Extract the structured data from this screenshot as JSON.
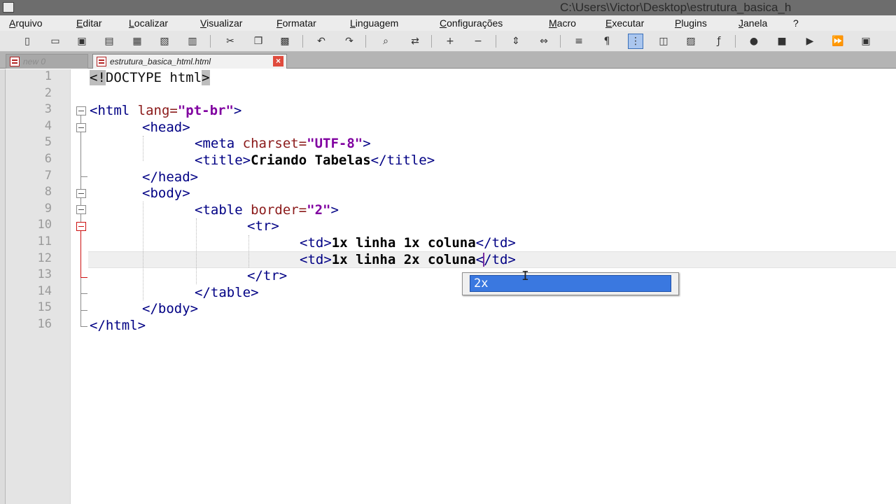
{
  "window": {
    "title": "C:\\Users\\Victor\\Desktop\\estrutura_basica_h"
  },
  "menu": {
    "items": [
      "Arquivo",
      "Editar",
      "Localizar",
      "Visualizar",
      "Formatar",
      "Linguagem",
      "Configurações",
      "Macro",
      "Executar",
      "Plugins",
      "Janela",
      "?"
    ]
  },
  "toolbar": {
    "icons": [
      "new-file-icon",
      "open-file-icon",
      "save-icon",
      "save-all-icon",
      "close-icon",
      "close-all-icon",
      "print-icon",
      "cut-icon",
      "copy-icon",
      "paste-icon",
      "undo-icon",
      "redo-icon",
      "find-icon",
      "replace-icon",
      "zoom-in-icon",
      "zoom-out-icon",
      "sync-vertical-icon",
      "sync-horizontal-icon",
      "word-wrap-icon",
      "show-all-chars-icon",
      "indent-guide-icon",
      "user-language-icon",
      "doc-map-icon",
      "function-list-icon",
      "macro-record-icon",
      "macro-stop-icon",
      "macro-play-icon",
      "macro-run-multiple-icon",
      "macro-save-icon"
    ]
  },
  "tabs": [
    {
      "label": "new 0",
      "active": false
    },
    {
      "label": "estrutura_basica_html.html",
      "active": true
    }
  ],
  "editor": {
    "line_numbers": [
      "1",
      "2",
      "3",
      "4",
      "5",
      "6",
      "7",
      "8",
      "9",
      "10",
      "11",
      "12",
      "13",
      "14",
      "15",
      "16"
    ],
    "lines": {
      "l1": {
        "open": "<!",
        "doctype": "DOCTYPE html",
        "close": ">"
      },
      "l3": {
        "tag_open": "<html ",
        "attr": "lang=",
        "value": "\"pt-br\"",
        "tag_close": ">"
      },
      "l4": {
        "tag": "<head>"
      },
      "l5": {
        "tag_open": "<meta ",
        "attr": "charset=",
        "value": "\"UTF-8\"",
        "tag_close": ">"
      },
      "l6": {
        "tag_open": "<title>",
        "text": "Criando Tabelas",
        "tag_close": "</title>"
      },
      "l7": {
        "tag": "</head>"
      },
      "l8": {
        "tag": "<body>"
      },
      "l9": {
        "tag_open": "<table ",
        "attr": "border=",
        "value": "\"2\"",
        "tag_close": ">"
      },
      "l10": {
        "tag": "<tr>"
      },
      "l11": {
        "tag_open": "<td>",
        "text": "1x linha 1x coluna",
        "tag_close": "</td>"
      },
      "l12": {
        "tag_open": "<td>",
        "text": "1x linha 2x coluna",
        "tag_close": "</td>"
      },
      "l13": {
        "tag": "</tr>"
      },
      "l14": {
        "tag": "</table>"
      },
      "l15": {
        "tag": "</body>"
      },
      "l16": {
        "tag": "</html>"
      }
    }
  },
  "autocomplete": {
    "selected": "2x"
  },
  "colors": {
    "tag": "#000084",
    "attribute": "#8b1a1a",
    "string": "#8000a0",
    "selection": "#3a78e0"
  }
}
